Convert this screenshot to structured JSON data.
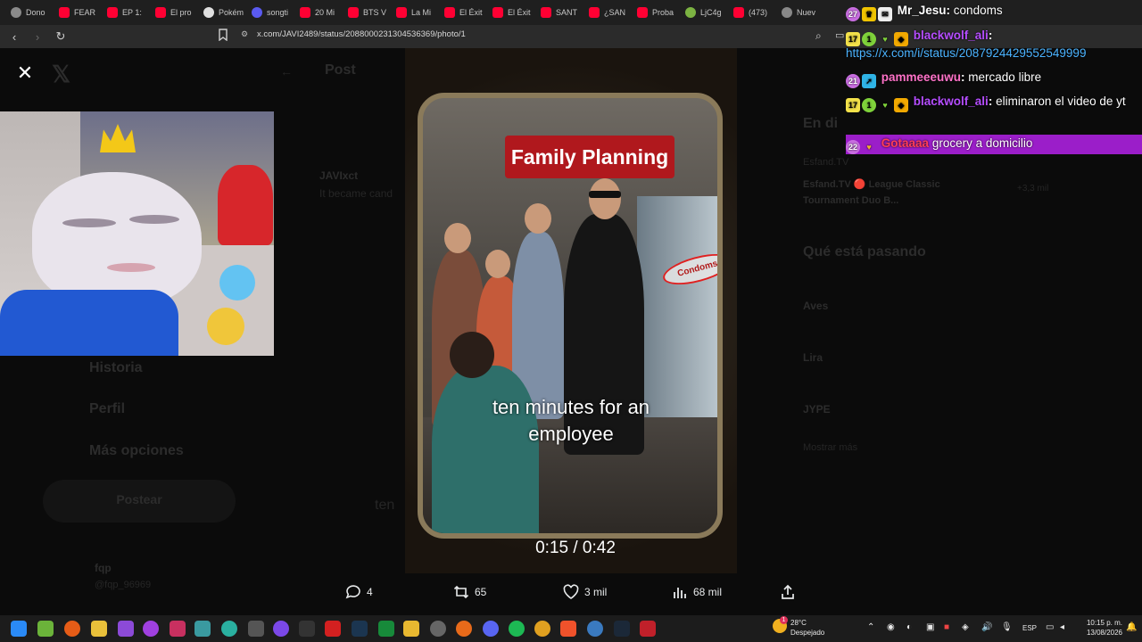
{
  "tabs": [
    {
      "label": "Dono",
      "icon": "globe-icon",
      "color": "#8a8a8a"
    },
    {
      "label": "FEAR",
      "icon": "youtube-icon",
      "color": "#ff0033"
    },
    {
      "label": "EP 1:",
      "icon": "youtube-icon",
      "color": "#ff0033"
    },
    {
      "label": "El pro",
      "icon": "youtube-icon",
      "color": "#ff0033"
    },
    {
      "label": "Pokém",
      "icon": "pokemon-icon",
      "color": "#e0e0e0"
    },
    {
      "label": "songti",
      "icon": "x-icon",
      "color": "#5a5af0"
    },
    {
      "label": "20 Mi",
      "icon": "youtube-icon",
      "color": "#ff0033"
    },
    {
      "label": "BTS V",
      "icon": "youtube-icon",
      "color": "#ff0033"
    },
    {
      "label": "La Mi",
      "icon": "youtube-icon",
      "color": "#ff0033"
    },
    {
      "label": "El Éxit",
      "icon": "youtube-icon",
      "color": "#ff0033"
    },
    {
      "label": "El Éxit",
      "icon": "youtube-icon",
      "color": "#ff0033"
    },
    {
      "label": "SANT",
      "icon": "youtube-icon",
      "color": "#ff0033"
    },
    {
      "label": "¿SAN",
      "icon": "youtube-icon",
      "color": "#ff0033"
    },
    {
      "label": "Proba",
      "icon": "youtube-icon",
      "color": "#ff0033"
    },
    {
      "label": "LjC4g",
      "icon": "lj-icon",
      "color": "#7cb342"
    },
    {
      "label": "(473)",
      "icon": "youtube-icon",
      "color": "#ff0033"
    },
    {
      "label": "Nuev",
      "icon": "shield-icon",
      "color": "#888888"
    }
  ],
  "address": {
    "url": "x.com/JAVI2489/status/2088000231304536369/photo/1"
  },
  "background_page": {
    "post_header": "Post",
    "author": "JAVIxct",
    "tweet_text": "It became cand",
    "menu_items": [
      "Historia",
      "Perfil",
      "Más opciones"
    ],
    "post_button": "Postear",
    "profile_name": "fqp",
    "profile_handle": "@fqp_96969",
    "section_live": "En di",
    "live_1": "Esfand.TV",
    "live_2": "Esfand.TV 🔴 League Classic Tournament Duo B...",
    "live_count": "+3,3 mil",
    "trending_title": "Qué está pasando",
    "trend_1": "Aves",
    "trend_2": "Lira",
    "trend_3": "JYPE",
    "trend_4": "Mostrar más",
    "caption_echo": "ten"
  },
  "video": {
    "sign": "Family Planning",
    "condoms_label": "Condoms",
    "caption_line1": "ten minutes for an",
    "caption_line2": "employee",
    "timecode": "0:15 / 0:42"
  },
  "actions": {
    "replies": "4",
    "reposts": "65",
    "likes": "3 mil",
    "views": "68 mil"
  },
  "chat": [
    {
      "badges": [
        "27",
        "crown",
        "gift"
      ],
      "user": "Mr_Jesu",
      "text": "condoms"
    },
    {
      "badges": [
        "17",
        "1",
        "heart",
        "cube"
      ],
      "user": "blackwolf_ali",
      "text": "https://x.com/i/status/2087924429552549999"
    },
    {
      "badges": [
        "21",
        "arrow"
      ],
      "user": "pammeeeuwu",
      "text": "mercado libre"
    },
    {
      "badges": [
        "17",
        "1",
        "heart",
        "cube"
      ],
      "user": "blackwolf_ali",
      "text": "eliminaron el video de yt"
    },
    {
      "badges": [
        "22",
        "heart"
      ],
      "user": "Gotaaaa",
      "text": "grocery a domicilio"
    }
  ],
  "taskbar": {
    "weather_temp": "28°C",
    "weather_text": "Despejado",
    "lang": "ESP",
    "time": "10:15 p. m.",
    "date": "13/08/2026",
    "notif_count": "1"
  }
}
